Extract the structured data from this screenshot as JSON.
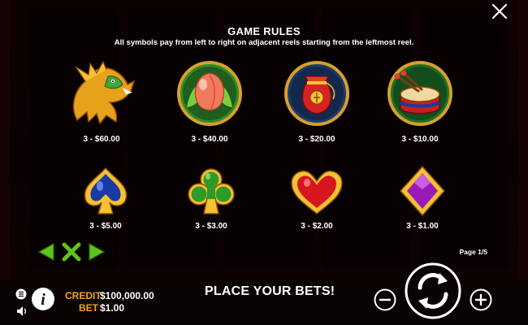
{
  "dialog": {
    "title": "GAME RULES",
    "subtitle": "All symbols pay from left to right on adjacent reels starting from the leftmost reel."
  },
  "symbols": [
    {
      "name": "dragon",
      "icon": "dragon-icon",
      "pay": "3 - $60.00"
    },
    {
      "name": "peach",
      "icon": "peach-icon",
      "pay": "3 - $40.00"
    },
    {
      "name": "money-bag",
      "icon": "money-bag-icon",
      "pay": "3 - $20.00"
    },
    {
      "name": "drum",
      "icon": "drum-icon",
      "pay": "3 - $10.00"
    },
    {
      "name": "spade",
      "icon": "spade-icon",
      "pay": "3 - $5.00"
    },
    {
      "name": "club",
      "icon": "club-icon",
      "pay": "3 - $3.00"
    },
    {
      "name": "heart",
      "icon": "heart-icon",
      "pay": "3 - $2.00"
    },
    {
      "name": "diamond",
      "icon": "diamond-icon",
      "pay": "3 - $1.00"
    }
  ],
  "pagination": {
    "page": "Page 1/5"
  },
  "footer": {
    "credit_label": "CREDIT",
    "credit_value": "$100,000.00",
    "bet_label": "BET",
    "bet_value": "$1.00",
    "status": "PLACE YOUR BETS!"
  },
  "colors": {
    "accent": "#f2a51c",
    "nav_green": "#5fc21e",
    "overlay": "#000000",
    "background": "#3a0a0a"
  }
}
